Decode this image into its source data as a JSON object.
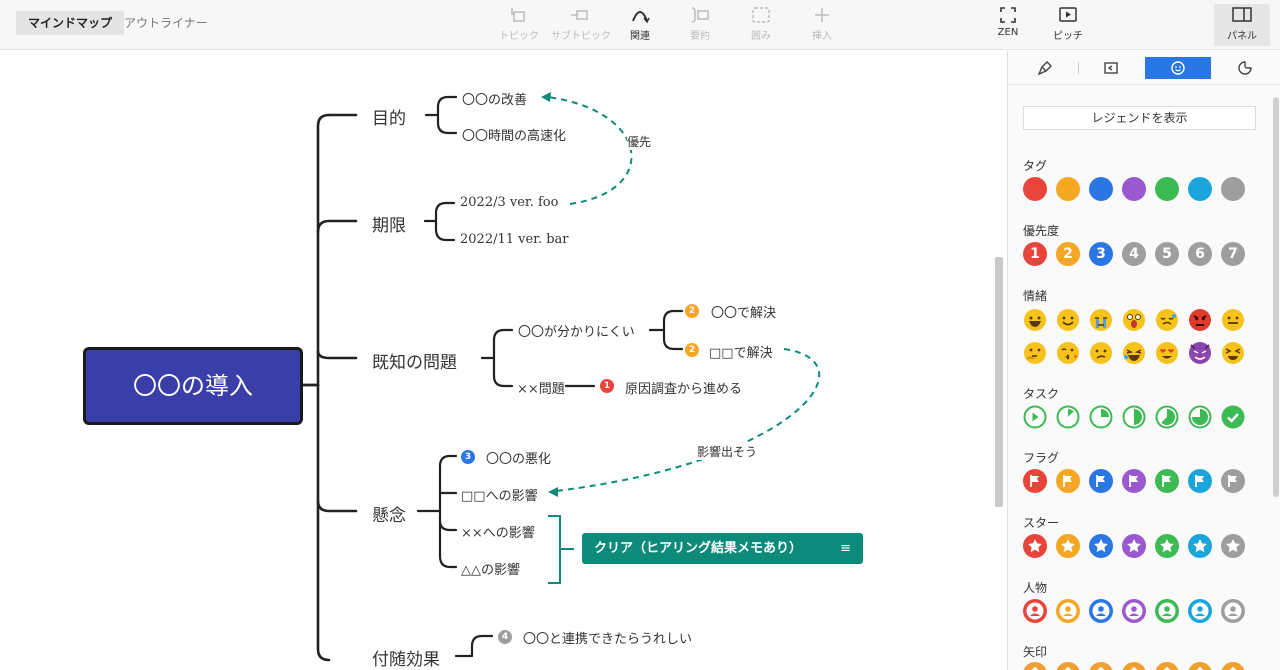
{
  "toolbar": {
    "tab_mindmap": "マインドマップ",
    "tab_outliner": "アウトライナー",
    "topic": "トピック",
    "subtopic": "サブトピック",
    "relation": "関連",
    "summary": "要約",
    "boundary": "囲み",
    "insert": "挿入",
    "zen": "ZEN",
    "pitch": "ピッチ",
    "panel": "パネル"
  },
  "map": {
    "central": "〇〇の導入",
    "branches": {
      "purpose": {
        "label": "目的",
        "children": [
          "〇〇の改善",
          "〇〇時間の高速化"
        ]
      },
      "deadline": {
        "label": "期限",
        "children": [
          "2022/3 ver. foo",
          "2022/11 ver. bar"
        ]
      },
      "issues": {
        "label": "既知の問題",
        "child1": "〇〇が分かりにくい",
        "child1_sub": [
          "〇〇で解決",
          "□□で解決"
        ],
        "child2": "××問題",
        "child2_sub": "原因調査から進める"
      },
      "concerns": {
        "label": "懸念",
        "children": [
          "〇〇の悪化",
          "□□への影響",
          "××への影響",
          "△△の影響"
        ],
        "summary": "クリア（ヒアリング結果メモあり）"
      },
      "side_effects": {
        "label": "付随効果",
        "child1": "〇〇と連携できたらうれしい"
      }
    },
    "relationships": [
      "優先",
      "影響出そう"
    ],
    "badges": {
      "issue_sub1": "2",
      "issue_sub2": "2",
      "issue_cause": "1",
      "concern_first": "3",
      "side_first": "4"
    }
  },
  "panel": {
    "legend_button": "レジェンドを表示",
    "sections": {
      "tag": "タグ",
      "priority": "優先度",
      "emotion": "情緒",
      "task": "タスク",
      "flag": "フラグ",
      "star": "スター",
      "person": "人物",
      "arrow": "矢印"
    },
    "priority_numbers": [
      "1",
      "2",
      "3",
      "4",
      "5",
      "6",
      "7"
    ],
    "colors": [
      "#e8443a",
      "#f5a623",
      "#2b76e5",
      "#9b59d0",
      "#3cba54",
      "#1aa6dc",
      "#9e9e9e"
    ],
    "emotion_icons": [
      "grin-icon",
      "smile-icon",
      "crying-icon",
      "shocked-icon",
      "tired-icon",
      "angry-icon",
      "neutral-icon",
      "thinking-icon",
      "kiss-icon",
      "confused-icon",
      "rofl-icon",
      "heart-eyes-icon",
      "devil-icon",
      "squint-icon"
    ]
  }
}
